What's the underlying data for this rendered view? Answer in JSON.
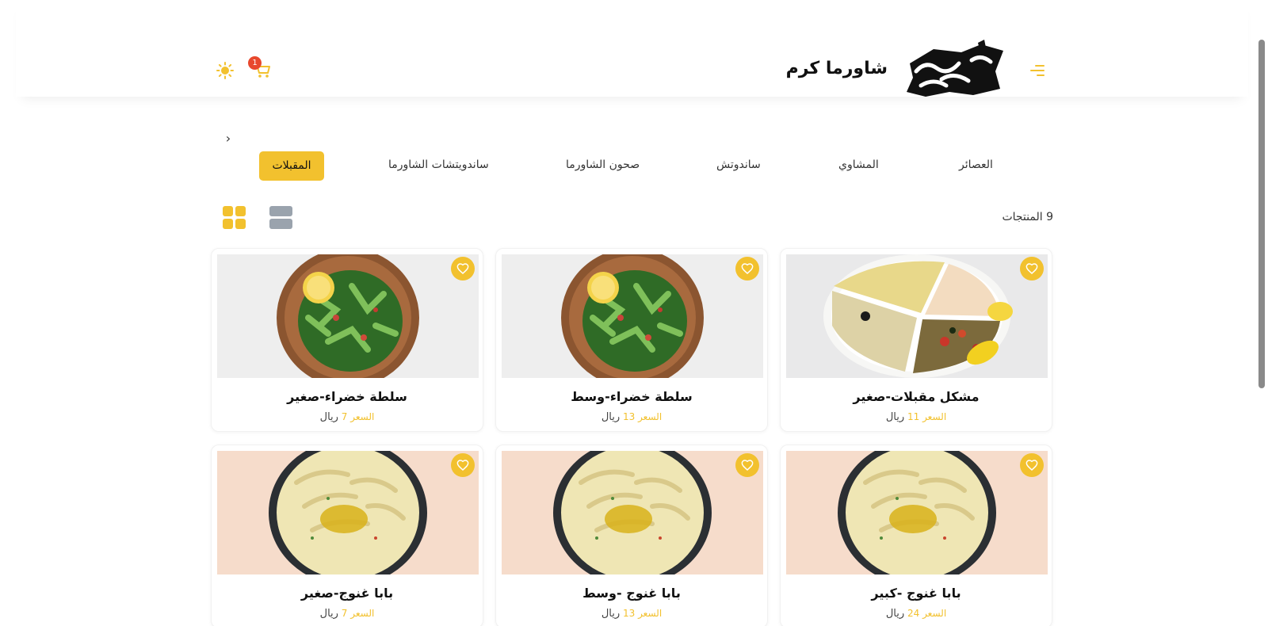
{
  "header": {
    "brand": "شاورما كرم",
    "cart_count": "1"
  },
  "categories": [
    {
      "label": "العصائر"
    },
    {
      "label": "المشاوي"
    },
    {
      "label": "ساندوتش"
    },
    {
      "label": "صحون الشاورما"
    },
    {
      "label": "ساندويتشات الشاورما"
    },
    {
      "label": "المقبلات"
    }
  ],
  "active_category": "المقبلات",
  "products_count": "9 المنتجات",
  "products": [
    {
      "name": "مشكل مقبلات-صغير",
      "price_label": "السعر",
      "price": "11",
      "currency": "ريال",
      "image": "mezze-platter"
    },
    {
      "name": "سلطة خضراء-وسط",
      "price_label": "السعر",
      "price": "13",
      "currency": "ريال",
      "image": "green-salad"
    },
    {
      "name": "سلطة خضراء-صغير",
      "price_label": "السعر",
      "price": "7",
      "currency": "ريال",
      "image": "green-salad"
    },
    {
      "name": "بابا غنوج -كبير",
      "price_label": "السعر",
      "price": "24",
      "currency": "ريال",
      "image": "baba-ghanoush"
    },
    {
      "name": "بابا غنوج -وسط",
      "price_label": "السعر",
      "price": "13",
      "currency": "ريال",
      "image": "baba-ghanoush"
    },
    {
      "name": "بابا غنوج-صغير",
      "price_label": "السعر",
      "price": "7",
      "currency": "ريال",
      "image": "baba-ghanoush"
    }
  ],
  "colors": {
    "accent": "#f2c12e",
    "badge": "#e8482d",
    "list_toggle": "#9aa3ad"
  }
}
